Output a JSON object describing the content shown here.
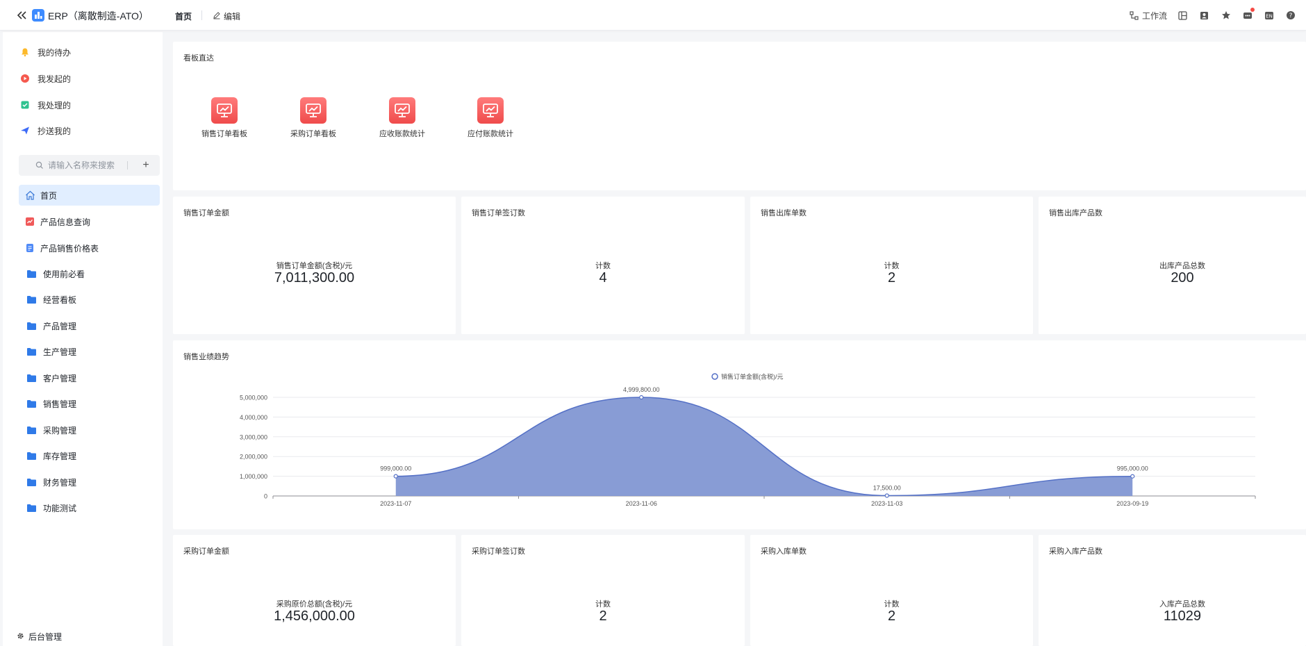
{
  "header": {
    "app_title": "ERP（离散制造-ATO）",
    "nav_home": "首页",
    "nav_edit": "编辑",
    "workflow_label": "工作流"
  },
  "sidebar": {
    "todo": [
      {
        "label": "我的待办",
        "icon": "bell-icon"
      },
      {
        "label": "我发起的",
        "icon": "play-icon"
      },
      {
        "label": "我处理的",
        "icon": "check-icon"
      },
      {
        "label": "抄送我的",
        "icon": "send-icon"
      }
    ],
    "search_placeholder": "请输入名称来搜索",
    "menu": [
      {
        "label": "首页",
        "icon": "home-icon",
        "active": true
      },
      {
        "label": "产品信息查询",
        "icon": "report-icon"
      },
      {
        "label": "产品销售价格表",
        "icon": "document-icon"
      },
      {
        "label": "使用前必看",
        "icon": "folder-icon"
      },
      {
        "label": "经营看板",
        "icon": "folder-icon"
      },
      {
        "label": "产品管理",
        "icon": "folder-icon"
      },
      {
        "label": "生产管理",
        "icon": "folder-icon"
      },
      {
        "label": "客户管理",
        "icon": "folder-icon"
      },
      {
        "label": "销售管理",
        "icon": "folder-icon"
      },
      {
        "label": "采购管理",
        "icon": "folder-icon"
      },
      {
        "label": "库存管理",
        "icon": "folder-icon"
      },
      {
        "label": "财务管理",
        "icon": "folder-icon"
      },
      {
        "label": "功能测试",
        "icon": "folder-icon"
      }
    ],
    "admin_label": "后台管理"
  },
  "board": {
    "title": "看板直达",
    "items": [
      {
        "label": "销售订单看板"
      },
      {
        "label": "采购订单看板"
      },
      {
        "label": "应收账款统计"
      },
      {
        "label": "应付账款统计"
      }
    ]
  },
  "sales_stats": [
    {
      "title": "销售订单金额",
      "label": "销售订单金额(含税)/元",
      "value": "7,011,300.00"
    },
    {
      "title": "销售订单签订数",
      "label": "计数",
      "value": "4"
    },
    {
      "title": "销售出库单数",
      "label": "计数",
      "value": "2"
    },
    {
      "title": "销售出库产品数",
      "label": "出库产品总数",
      "value": "200"
    }
  ],
  "purchase_stats": [
    {
      "title": "采购订单金额",
      "label": "采购原价总额(含税)/元",
      "value": "1,456,000.00"
    },
    {
      "title": "采购订单签订数",
      "label": "计数",
      "value": "2"
    },
    {
      "title": "采购入库单数",
      "label": "计数",
      "value": "2"
    },
    {
      "title": "采购入库产品数",
      "label": "入库产品总数",
      "value": "11029"
    }
  ],
  "trend": {
    "title": "销售业绩趋势"
  },
  "colors": {
    "accent": "#3d8bff",
    "active_bg": "#e1eeff",
    "area_fill": "#8297d3",
    "area_line": "#5470c6",
    "board_icon": "#ef4b4b"
  },
  "chart_data": {
    "type": "area",
    "title": "销售业绩趋势",
    "categories": [
      "2023-11-07",
      "2023-11-06",
      "2023-11-03",
      "2023-09-19"
    ],
    "series": [
      {
        "name": "销售订单金额(含税)/元",
        "values": [
          999000,
          4999800,
          17500,
          995000
        ]
      }
    ],
    "data_labels": [
      "999,000.00",
      "4,999,800.00",
      "17,500.00",
      "995,000.00"
    ],
    "y_ticks": [
      "0",
      "1,000,000",
      "2,000,000",
      "3,000,000",
      "4,000,000",
      "5,000,000"
    ],
    "ylim": [
      0,
      5000000
    ],
    "grid": true,
    "legend_position": "top-center"
  }
}
